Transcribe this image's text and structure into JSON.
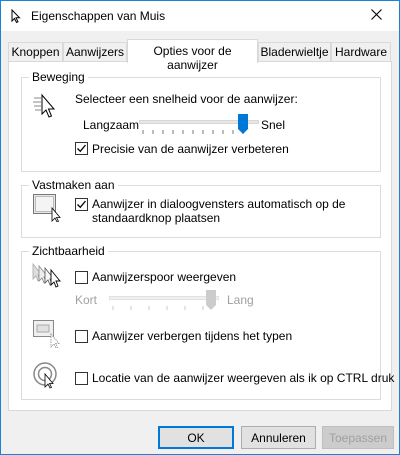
{
  "window": {
    "title": "Eigenschappen van Muis",
    "colors": {
      "accent": "#0078d7",
      "border": "#1883d7"
    }
  },
  "tabs": [
    {
      "label": "Knoppen",
      "active": false
    },
    {
      "label": "Aanwijzers",
      "active": false
    },
    {
      "label": "Opties voor de aanwijzer",
      "active": true
    },
    {
      "label": "Bladerwieltje",
      "active": false
    },
    {
      "label": "Hardware",
      "active": false
    }
  ],
  "motion": {
    "legend": "Beweging",
    "speed_label": "Selecteer een snelheid voor de aanwijzer:",
    "slow_label": "Langzaam",
    "fast_label": "Snel",
    "speed_level": 1.0,
    "precision_label": "Precisie van de aanwijzer verbeteren",
    "precision_checked": true,
    "icon": "pointer-speed-icon"
  },
  "snap": {
    "legend": "Vastmaken aan",
    "label": "Aanwijzer in dialoogvensters automatisch op de standaardknop plaatsen",
    "label_line1": "Aanwijzer in dialoogvensters automatisch op de",
    "label_line2": "standaardknop plaatsen",
    "checked": true,
    "icon": "snap-to-default-icon"
  },
  "visibility": {
    "legend": "Zichtbaarheid",
    "trails_label": "Aanwijzerspoor weergeven",
    "trails_checked": false,
    "short_label": "Kort",
    "long_label": "Lang",
    "trails_level": 1.0,
    "hide_label": "Aanwijzer verbergen tijdens het typen",
    "hide_checked": false,
    "ctrl_label": "Locatie van de aanwijzer weergeven als ik op CTRL druk",
    "ctrl_checked": false,
    "icons": [
      "pointer-trails-icon",
      "hide-while-typing-icon",
      "show-location-icon"
    ]
  },
  "buttons": {
    "ok": "OK",
    "cancel": "Annuleren",
    "apply": "Toepassen"
  }
}
